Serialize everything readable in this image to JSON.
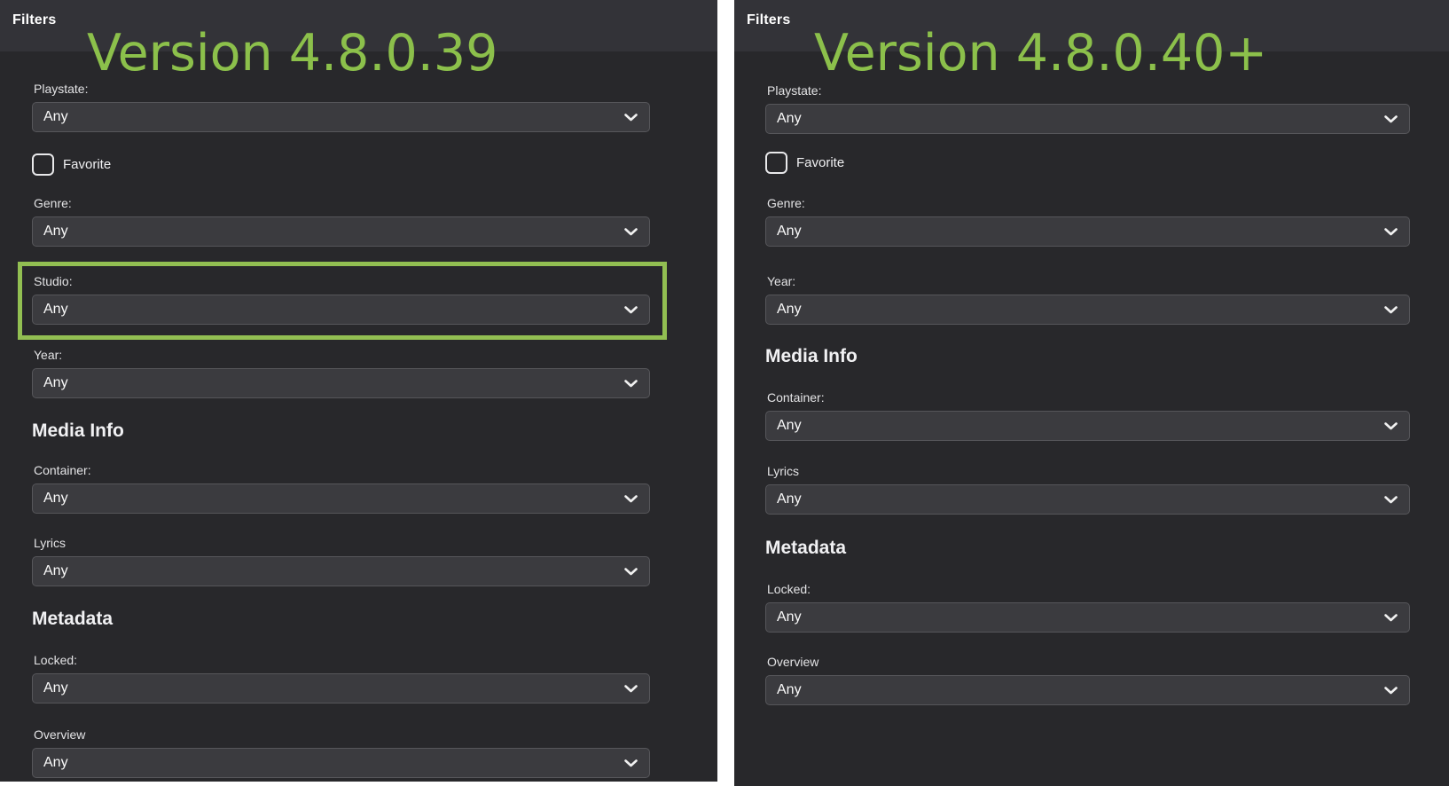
{
  "colors": {
    "title_green": "#8cc04b",
    "highlight_green": "#92bf52",
    "panel_bg": "#28282b",
    "header_bg": "#333338",
    "select_bg": "#3b3b3f",
    "divider": "#ffffff"
  },
  "left": {
    "header_title": "Filters",
    "version_title": "Version 4.8.0.39",
    "headings": {
      "media_info": "Media Info",
      "metadata": "Metadata"
    },
    "fields": {
      "playstate": {
        "label": "Playstate:",
        "value": "Any"
      },
      "favorite": {
        "label": "Favorite",
        "checked": false
      },
      "genre": {
        "label": "Genre:",
        "value": "Any"
      },
      "studio": {
        "label": "Studio:",
        "value": "Any",
        "highlighted": true
      },
      "year": {
        "label": "Year:",
        "value": "Any"
      },
      "container": {
        "label": "Container:",
        "value": "Any"
      },
      "lyrics": {
        "label": "Lyrics",
        "value": "Any"
      },
      "locked": {
        "label": "Locked:",
        "value": "Any"
      },
      "overview": {
        "label": "Overview",
        "value": "Any"
      }
    }
  },
  "right": {
    "header_title": "Filters",
    "version_title": "Version 4.8.0.40+",
    "headings": {
      "media_info": "Media Info",
      "metadata": "Metadata"
    },
    "fields": {
      "playstate": {
        "label": "Playstate:",
        "value": "Any"
      },
      "favorite": {
        "label": "Favorite",
        "checked": false
      },
      "genre": {
        "label": "Genre:",
        "value": "Any"
      },
      "year": {
        "label": "Year:",
        "value": "Any"
      },
      "container": {
        "label": "Container:",
        "value": "Any"
      },
      "lyrics": {
        "label": "Lyrics",
        "value": "Any"
      },
      "locked": {
        "label": "Locked:",
        "value": "Any"
      },
      "overview": {
        "label": "Overview",
        "value": "Any"
      }
    }
  }
}
